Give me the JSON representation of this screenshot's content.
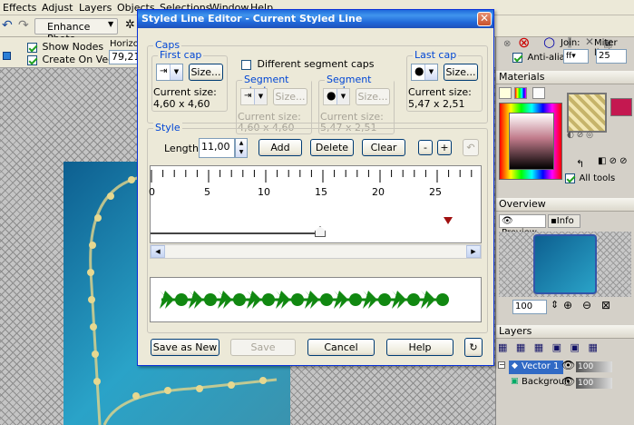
{
  "menu": {
    "items": [
      "Effects",
      "Adjust",
      "Layers",
      "Objects",
      "Selections",
      "Window",
      "Help"
    ]
  },
  "toolbar": {
    "enhance_photo": "Enhance Photo"
  },
  "tool_options": {
    "show_nodes": "Show Nodes",
    "create_on_vector": "Create On Vector",
    "horizontal_label": "Horizont...",
    "horizontal_value": "79,21"
  },
  "right_toolbar": {
    "anti_alias": "Anti-alias",
    "join_label": "Join:",
    "miter_label": "Miter limit:",
    "miter_value": "25"
  },
  "materials": {
    "title": "Materials",
    "all_tools": "All tools"
  },
  "overview": {
    "title": "Overview",
    "tab_preview": "Preview",
    "tab_info": "Info",
    "zoom_value": "100"
  },
  "layers": {
    "title": "Layers",
    "rows": [
      {
        "name": "Vector 1",
        "opacity": "100"
      },
      {
        "name": "Backgroun",
        "opacity": "100"
      }
    ]
  },
  "dialog": {
    "title": "Styled Line Editor - Current Styled Line",
    "caps_label": "Caps",
    "first_cap_label": "First cap",
    "size_button": "Size...",
    "current_size_label": "Current size:",
    "first_cap_size": "4,60 x 4,60",
    "different_caps": "Different segment caps",
    "last_cap_label": "Last cap",
    "last_cap_size": "5,47 x 2,51",
    "segment_start_label": "Segment start",
    "segment_start_size": "4,60 x 4,60",
    "segment_end_label": "Segment end",
    "segment_end_size": "5,47 x 2,51",
    "style_label": "Style",
    "length_label": "Length",
    "length_value": "11,00",
    "add": "Add",
    "delete": "Delete",
    "clear": "Clear",
    "minus": "-",
    "plus": "+",
    "ruler_ticks": [
      "0",
      "5",
      "10",
      "15",
      "20",
      "25"
    ],
    "save_as_new": "Save as New",
    "save": "Save",
    "cancel": "Cancel",
    "help": "Help"
  }
}
